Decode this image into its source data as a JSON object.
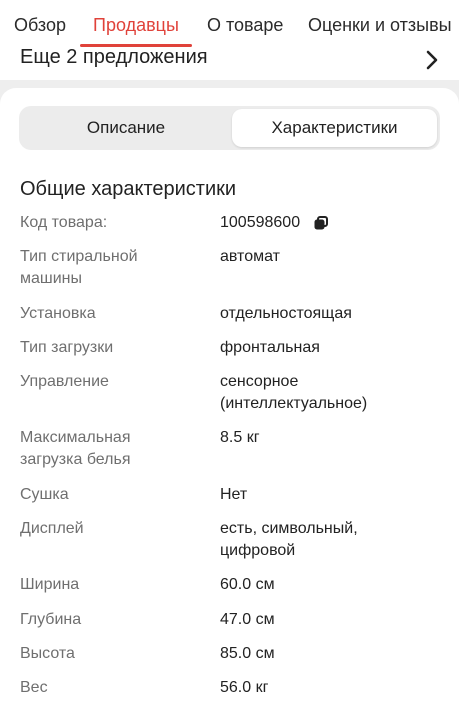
{
  "nav": {
    "tabs": [
      {
        "label": "Обзор"
      },
      {
        "label": "Продавцы",
        "active": true
      },
      {
        "label": "О товаре"
      },
      {
        "label": "Оценки и отзывы"
      }
    ]
  },
  "offers": {
    "label": "Еще 2 предложения",
    "icon": "chevron-right-icon"
  },
  "segmented": {
    "left": "Описание",
    "right": "Характеристики",
    "selected": "right"
  },
  "section": {
    "title": "Общие характеристики"
  },
  "specs": [
    {
      "label": "Код товара:",
      "value": "100598600",
      "copy_icon": "copy-icon"
    },
    {
      "label": "Тип стиральной машины",
      "value": "автомат"
    },
    {
      "label": "Установка",
      "value": "отдельностоящая"
    },
    {
      "label": "Тип загрузки",
      "value": "фронтальная"
    },
    {
      "label": "Управление",
      "value": "сенсорное (интеллектуальное)"
    },
    {
      "label": "Максимальная загрузка белья",
      "value": "8.5 кг"
    },
    {
      "label": "Сушка",
      "value": "Нет"
    },
    {
      "label": "Дисплей",
      "value": "есть, символьный, цифровой"
    },
    {
      "label": "Ширина",
      "value": "60.0 см"
    },
    {
      "label": "Глубина",
      "value": "47.0 см"
    },
    {
      "label": "Высота",
      "value": "85.0 см"
    },
    {
      "label": "Вес",
      "value": "56.0 кг"
    }
  ],
  "colors": {
    "accent": "#e0423a",
    "label": "#6f6f6f",
    "text": "#222222",
    "background": "#eeeeee"
  }
}
